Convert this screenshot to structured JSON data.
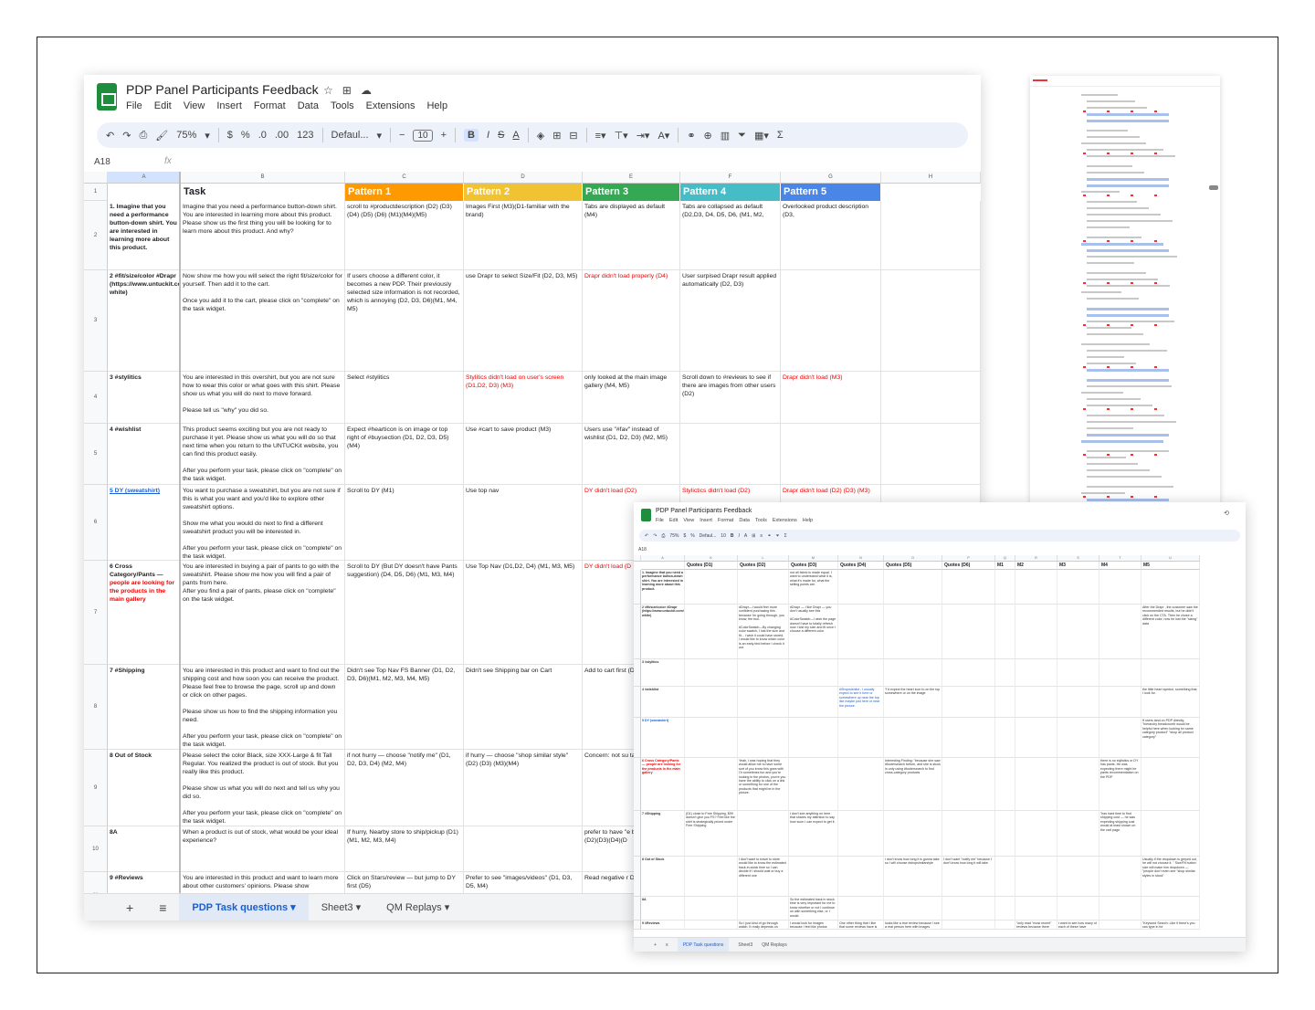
{
  "main": {
    "title": "PDP Panel Participants Feedback",
    "menu": [
      "File",
      "Edit",
      "View",
      "Insert",
      "Format",
      "Data",
      "Tools",
      "Extensions",
      "Help"
    ],
    "toolbar": {
      "zoom": "75%",
      "currency": "$",
      "percent": "%",
      "dec_dec": ".0",
      "dec_inc": ".00",
      "num_format": "123",
      "font": "Defaul...",
      "font_size": "10",
      "minus": "−",
      "plus": "+",
      "bold": "B",
      "italic": "I",
      "strike": "S",
      "textcolor": "A"
    },
    "cell_ref": "A18",
    "fx": "fx",
    "columns": [
      "A",
      "B",
      "C",
      "D",
      "E",
      "F",
      "G",
      "H"
    ],
    "header_row": {
      "task": "Task",
      "patterns": [
        {
          "label": "Pattern 1",
          "color": "#ff9900"
        },
        {
          "label": "Pattern 2",
          "color": "#f1c232"
        },
        {
          "label": "Pattern 3",
          "color": "#34a853"
        },
        {
          "label": "Pattern 4",
          "color": "#46bdc6"
        },
        {
          "label": "Pattern 5",
          "color": "#4a86e8"
        }
      ]
    },
    "rows": [
      {
        "num": "2",
        "a": "1. Imagine that you need a performance button-down shirt. You are interested in learning more about this product.",
        "b": "Imagine that you need a performance button-down shirt. You are interested in learning more about this product.\nPlease show us the first thing you will be looking for to learn more about this product. And why?",
        "c": "scroll to #productdescription (D2) (D3) (D4) (D5) (D6) (M1)(M4)(M5)",
        "d": "Images First (M3)(D1-familiar with the brand)",
        "e": "Tabs are displayed as default (M4)",
        "f": "Tabs are collapsed as default (D2,D3, D4, D5, D6, (M1, M2,",
        "g": "Overlooked product description (D3,"
      },
      {
        "num": "3",
        "a": "2 #fit/size/color #Drapr (https://www.untuckit.com/products/gironde-white)",
        "b": "Now show me how you will select the right fit/size/color for yourself. Then add it to the cart.\n\nOnce you add it to the cart, please click on \"complete\" on the task widget.",
        "c": "If users choose a different color, it becomes a new PDP. Their previously selected size information is not recorded, which is annoying (D2, D3, D6)(M1, M4, M5)",
        "d": "use Drapr to select Size/Fit (D2, D3, M5)",
        "e": "Drapr didn't load properly (D4)",
        "f": "User surpised Drapr result applied automatically (D2, D3)",
        "g": ""
      },
      {
        "num": "4",
        "a": "3 #stylitics",
        "b": "You are interested in this overshirt, but you are not sure how to wear this color or what goes with this shirt. Please show us what you will do next to move forward.\n\nPlease tell us \"why\" you did so.",
        "c": "Select #stylitics",
        "d": "Stylitics didn't load on user's screen (D1,D2, D3) (M3)",
        "e": "only looked at the main image gallery (M4, M5)",
        "f": "Scroll down to #reviews to see if there are images from other users (D2)",
        "g": "Drapr didn't load (M3)"
      },
      {
        "num": "5",
        "a": "4 #wishlist",
        "b": "This product seems exciting but you are not ready to purchase it yet. Please show us what you will do so that next time when you return to the UNTUCKit website, you can find this product easily.\n\nAfter you perform your task, please click on \"complete\" on the task widget.",
        "c": "Expect #hearticon is on image or top right of #buysection (D1, D2, D3, D5)(M4)",
        "d": "Use #cart to save product (M3)",
        "e": "Users use \"#fav\" instead of wishlist (D1, D2, D3) (M2, M5)",
        "f": "",
        "g": ""
      },
      {
        "num": "6",
        "a": "5 DY (sweatshirt)",
        "b": "You want to purchase a sweatshirt, but you are not sure if this is what you want and you'd like to explore other sweatshirt options.\n\nShow me what you would do next to find a different sweatshirt product you will be interested in.\n\nAfter you perform your task, please click on \"complete\" on the task widget.",
        "c": "Scroll to DY (M1)",
        "d": "Use top nav",
        "e": "DY didn't load (D2)",
        "f": "Stylictics didn't load (D2)",
        "g": "Drapr didn't load (D2) (D3) (M3)"
      },
      {
        "num": "7",
        "a": "6 Cross Category/Pants —",
        "a2": "people are looking for the products in the main gallery",
        "b": "You are interested in buying a pair of pants to go with the sweatshirt. Please show me how you will find a pair of pants from here.\nAfter you find a pair of pants, please click on \"complete\" on the task widget.",
        "c": "Scroll to DY (But DY doesn't have Pants suggestion) (D4, D5, D6) (M1, M3, M4)",
        "d": "Use Top Nav (D1,D2, D4) (M1, M3, M5)",
        "e": "DY didn't load (D",
        "f": "",
        "g": ""
      },
      {
        "num": "8",
        "a": "7 #Shipping",
        "b": "You are interested in this product and want to find out the shipping cost and how soon you can receive the product. Please feel free to browse the page, scroll up and down or click on other pages.\n\nPlease show us how to find the shipping information you need.\n\nAfter you perform your task, please click on \"complete\" on the task widget.",
        "c": "Didn't see Top Nav FS Banner (D1, D2, D3, D6)(M1, M2, M3, M4, M5)",
        "d": "Didn't see Shipping bar on Cart",
        "e": "Add to cart first (D1)(D3)(M2)(M",
        "f": "",
        "g": ""
      },
      {
        "num": "9",
        "a": "8 Out of Stock",
        "b": "Please select the color Black, size XXX-Large & fit Tall Regular. You realized the product is out of stock. But you really like this product.\n\nPlease show us what you will do next and tell us why you did so.\n\nAfter you perform your task, please click on \"complete\" on the task widget.",
        "c": "if not hurry — choose \"notify me\" (D1, D2, D3, D4) (M2, M4)",
        "d": "if hurry — choose \"shop similar style\" (D2) (D3) (M3)(M4)",
        "e": "Concern: not su take for \"notify n",
        "f": "",
        "g": ""
      },
      {
        "num": "10",
        "a": "8A",
        "b": "When a product is out of stock, what would be your ideal experience?",
        "c": "If hurry, Nearby store to ship/pickup (D1) (M1, M2, M3, M4)",
        "d": "",
        "e": "prefer to have \"e back-in-stock\" ti (D2)(D3)(D4)(D",
        "f": "",
        "g": ""
      },
      {
        "num": "11",
        "a": "9 #Reviews",
        "b": "You are interested in this product and want to learn more about other customers' opinions. Please show",
        "c": "Click on Stars/review — but jump to DY first (D5)",
        "d": "Prefer to see \"images/videos\" (D1, D3, D5, M4)",
        "e": "Read negative r D4) (M1",
        "f": "",
        "g": ""
      }
    ],
    "sheet_tabs": [
      {
        "label": "PDP Task questions",
        "active": true
      },
      {
        "label": "Sheet3",
        "active": false
      },
      {
        "label": "QM Replays",
        "active": false
      }
    ]
  },
  "overlay": {
    "title": "PDP Panel Participants Feedback",
    "menu": [
      "File",
      "Edit",
      "View",
      "Insert",
      "Format",
      "Data",
      "Tools",
      "Extensions",
      "Help"
    ],
    "cell_ref": "A18",
    "zoom": "75%",
    "font": "Defaul...",
    "font_size": "10",
    "headers": [
      "",
      "Quotes (D1)",
      "Quotes (D2)",
      "Quotes (D3)",
      "Quotes (D4)",
      "Quotes (D5)",
      "Quotes (D6)",
      "M1",
      "M2",
      "M3",
      "M4",
      "M5"
    ],
    "col_letters": [
      "A",
      "K",
      "L",
      "M",
      "N",
      "O",
      "P",
      "Q",
      "R",
      "S",
      "T",
      "U"
    ],
    "rows": [
      {
        "cells": [
          "1. Imagine that you need a performance button-down shirt. You are interested in learning more about this product.",
          "",
          "",
          "not all fabric is made equal. I want to understand what it is, what it's made for, what the selling points are.",
          "",
          "",
          "",
          "",
          "",
          "",
          "",
          ""
        ]
      },
      {
        "cells": [
          "2 #fit/size/color #Drapr (https://www.untuckit.com/products/gironde-white)",
          "",
          "#Drapr—I would feel more confident purchasing this because I'm going through, you know, the tool.\n\n#ColorSwatch—By changing color swatch, I lost the size and fit... I wish it could have stored.\nI would like to know which color is an early bird before I check it out.",
          "#Drapr — I like Drapr — you don't usually see this\n\n#ColorSwatch—I wish the page doesn't have to totally refresh now I lost my size and fit once I choose a different color",
          "",
          "",
          "",
          "",
          "",
          "",
          "",
          "After the Drapr , the customer saw the recommended results, but he didn't click on the CTA. Then he chose a different color, now he lost the \"sizing\" data"
        ]
      },
      {
        "cells": [
          "3 #stylitics",
          "",
          "",
          "",
          "",
          "",
          "",
          "",
          "",
          "",
          "",
          ""
        ]
      },
      {
        "cells": [
          "4 #wishlist",
          "",
          "",
          "",
          "#Shopwishlist - I usually expect to see it here or somewhere up near the top like maybe just here or near the picture.",
          "\"I'd expect the heart icon to on the top somewhere or on the image",
          "",
          "",
          "",
          "",
          "",
          "the little heart symbol, something that I look for."
        ]
      },
      {
        "cells": [
          "5 DY (sweatshirt)",
          "",
          "",
          "",
          "",
          "",
          "",
          "",
          "",
          "",
          "",
          "If users land on PDP directly, \"hierarchy breadcrumb would be helpful here when looking for same category product\" \"shop all product category\""
        ]
      },
      {
        "cells": [
          "6 Cross Category/Pants — people are looking for the products in the main gallery",
          "",
          "Yeah, I was hoping that they would allow me to have some sort of you know this goes with Or sometimes fun and you're looking in the photos, you're you have the ability to click on a link or something for one of the products that might be in the picture.",
          "",
          "",
          "Interesting Finding: \"because she saw #footersearch before, and she is stuck in only using #footersearch to find cross-category products",
          "",
          "",
          "",
          "",
          "there is no stylistics or DY has pants. He was expecting there might be pants recommendation on the PDP",
          ""
        ]
      },
      {
        "cells": [
          "7 #Shipping",
          "(D1) close to Free Shipping, $99 doesn't give you FS? Feel like the shirt is strategically priced under Free Shipping",
          "",
          "I don't see anything on here that shares my attention to say how soon I can expect to get it.",
          "",
          "",
          "",
          "",
          "",
          "",
          "\"has hard time to find shipping cost — he was expecting shipping cost would at least shown on the cart page.",
          ""
        ]
      },
      {
        "cells": [
          "8 Out of Stock",
          "",
          "I don't want to travel to store would like to know the estimated back-in-stock time so I can decide if I should wait or buy a different one",
          "",
          "",
          "I don't know how long it is gonna take so I will choose #shopsimilarstyle",
          "I don't want \"notify me\" because I don't know how long it will take",
          "",
          "",
          "",
          "",
          "Usually if the dropdown is greyed out, he will not choose it. \" Size/Fit button size will make him dropdown — \"people don't even see \"shop similar styles in stock\""
        ]
      },
      {
        "cells": [
          "8A",
          "",
          "",
          "So the estimated back in stock time is very important for me to know whether or not I continue on with something else, or I would",
          "",
          "",
          "",
          "",
          "",
          "",
          "",
          ""
        ]
      },
      {
        "cells": [
          "9 #Reviews",
          "",
          "So I just kind of go through watch. It really depends on",
          "I would look for images because I feel like photos",
          "One other thing that I like that some reviews have is",
          "looks like a true review because I see a real person here with images",
          "",
          "",
          "\"only read \"most recent\" reviews because there",
          "I want to see how many of each of these have",
          "",
          "\"Keyword Search: Like if there's you can type in for"
        ]
      }
    ],
    "sheet_tabs": [
      {
        "label": "PDP Task questions",
        "active": true
      },
      {
        "label": "Sheet3",
        "active": false
      },
      {
        "label": "QM Replays",
        "active": false
      }
    ]
  }
}
